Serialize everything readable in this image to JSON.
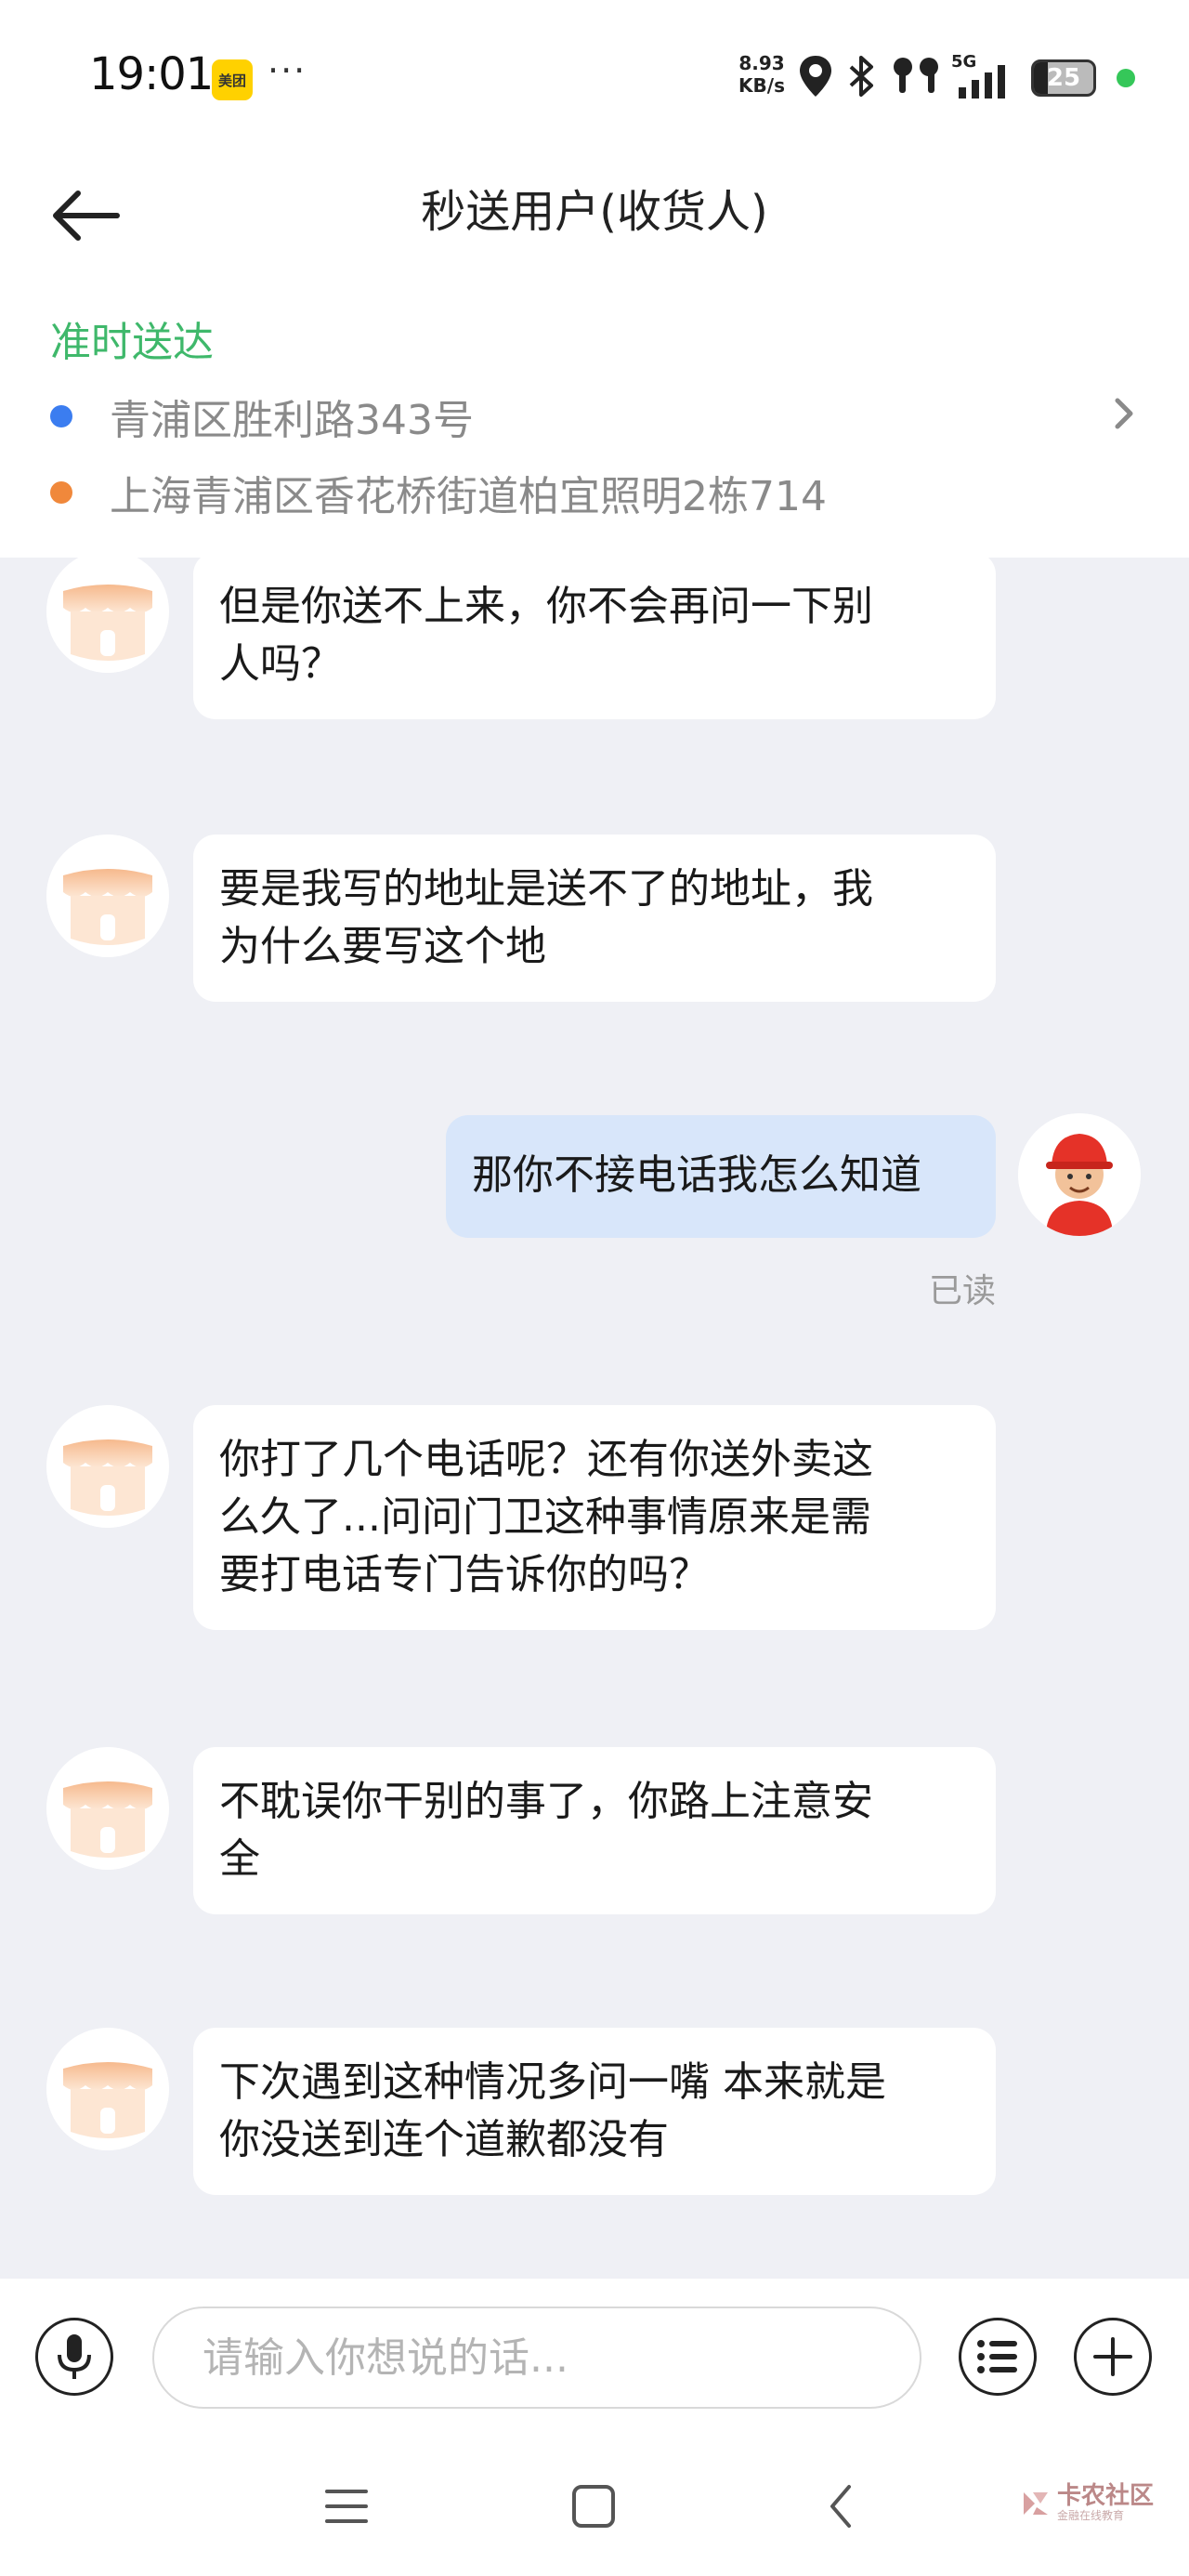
{
  "status_bar": {
    "time": "19:01",
    "app_badge": "美团",
    "more": "···",
    "net_speed_value": "8.93",
    "net_speed_unit": "KB/s",
    "network_type": "5G",
    "battery_level": "25",
    "icons": [
      "location-icon",
      "bluetooth-icon",
      "earbuds-icon",
      "signal-icon",
      "battery-icon"
    ]
  },
  "header": {
    "title": "秒送用户(收货人)",
    "delivery_status": "准时送达",
    "pickup_address": "青浦区胜利路343号",
    "dropoff_address": "上海青浦区香花桥街道柏宜照明2栋714",
    "pickup_dot_color": "#3b7df0",
    "dropoff_dot_color": "#f0883b"
  },
  "messages": [
    {
      "sender": "customer",
      "text_lines": [
        "但是你送不上来，你不会再问一下别",
        "人吗？"
      ]
    },
    {
      "sender": "customer",
      "text_lines": [
        "要是我写的地址是送不了的地址，我",
        "为什么要写这个地"
      ]
    },
    {
      "sender": "rider",
      "text_lines": [
        "那你不接电话我怎么知道"
      ],
      "status": "已读"
    },
    {
      "sender": "customer",
      "text_lines": [
        "你打了几个电话呢？还有你送外卖这",
        "么久了...问问门卫这种事情原来是需",
        "要打电话专门告诉你的吗？"
      ]
    },
    {
      "sender": "customer",
      "text_lines": [
        "不耽误你干别的事了，你路上注意安",
        "全"
      ]
    },
    {
      "sender": "customer",
      "text_lines": [
        "下次遇到这种情况多问一嘴 本来就是",
        "你没送到连个道歉都没有"
      ]
    }
  ],
  "input_bar": {
    "placeholder": "请输入你想说的话...",
    "icons": [
      "microphone-icon",
      "quick-reply-list-icon",
      "plus-icon"
    ]
  },
  "watermark": {
    "main": "卡农社区",
    "sub": "金融在线教育"
  },
  "colors": {
    "accent_green": "#3fb86b",
    "self_bubble": "#d8e6fa",
    "chat_background": "#eff0f5"
  }
}
